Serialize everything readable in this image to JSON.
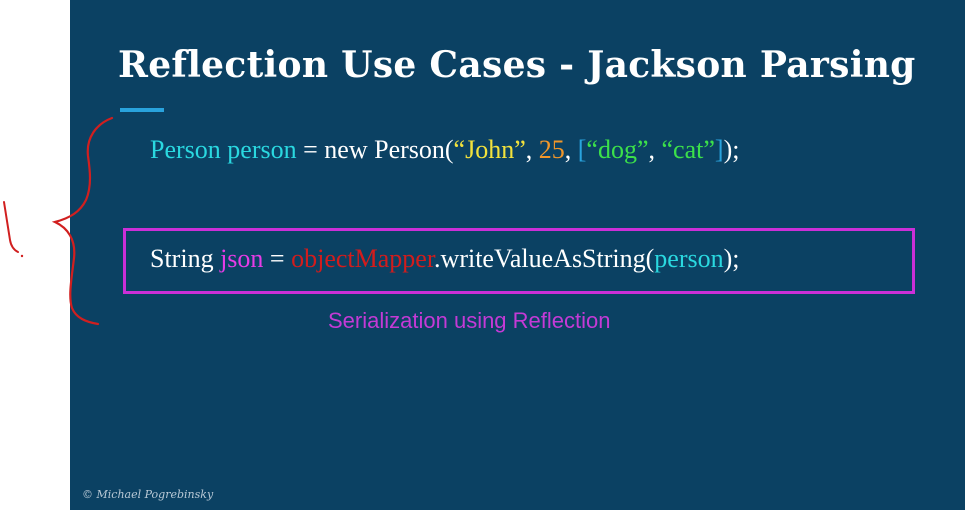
{
  "slide": {
    "title": "Reflection Use Cases - Jackson Parsing",
    "line1": {
      "type": "Person",
      "var": "person",
      "assign": "=",
      "new_kw": "new",
      "ctor": "Person(",
      "arg_name": "“John”",
      "comma1": ",",
      "arg_age": "25",
      "comma2": ",",
      "list_open": "[",
      "pet1": "“dog”",
      "comma3": ",",
      "pet2": "“cat”",
      "list_close": "]",
      "tail": ");"
    },
    "line2": {
      "type": "String",
      "var": "json",
      "assign": "=",
      "mapper": "objectMapper",
      "method": ".writeValueAsString(",
      "arg": "person",
      "tail": ");"
    },
    "caption": "Serialization using Reflection",
    "copyright": "© Michael Pogrebinsky"
  },
  "colors": {
    "background": "#0b4163",
    "accent": "#29a3dd",
    "highlight_box": "#cc2fd8",
    "annotation_ink": "#d11f1f"
  }
}
